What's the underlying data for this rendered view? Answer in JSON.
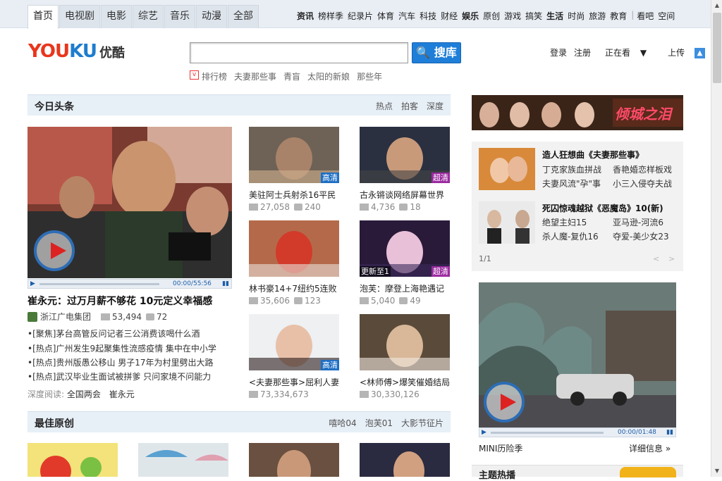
{
  "nav": {
    "tabs": [
      "首页",
      "电视剧",
      "电影",
      "综艺",
      "音乐",
      "动漫",
      "全部"
    ],
    "channels": [
      {
        "label": "资讯",
        "bold": true
      },
      {
        "label": "榜样季"
      },
      {
        "label": "纪录片"
      },
      {
        "label": "体育"
      },
      {
        "label": "汽车"
      },
      {
        "label": "科技"
      },
      {
        "label": "财经"
      },
      {
        "label": "娱乐",
        "bold": true
      },
      {
        "label": "原创"
      },
      {
        "label": "游戏"
      },
      {
        "label": "搞笑"
      },
      {
        "label": "生活",
        "bold": true
      },
      {
        "label": "时尚"
      },
      {
        "label": "旅游"
      },
      {
        "label": "教育"
      }
    ],
    "extra": [
      "看吧",
      "空间"
    ]
  },
  "logo": {
    "brand_en": "YOUKU",
    "brand_cn": "优酷"
  },
  "search": {
    "value": "",
    "button": "搜库"
  },
  "hot_searches": [
    "排行榜",
    "夫妻那些事",
    "青盲",
    "太阳的新娘",
    "那些年"
  ],
  "user": {
    "login": "登录",
    "register": "注册",
    "watching": "正在看",
    "upload": "上传"
  },
  "today": {
    "title": "今日头条",
    "links": [
      "热点",
      "拍客",
      "深度"
    ],
    "main_video": {
      "time": "00:00/55:56",
      "headline": "崔永元：过万月薪不够花 10元定义幸福感",
      "source": "浙江广电集团",
      "plays": "53,494",
      "comments": "72"
    },
    "news": [
      "•[聚焦]茅台高管反问记者三公消费该喝什么酒",
      "•[热点]广州发生9起聚集性流感疫情 集中在中小学",
      "•[热点]贵州版愚公移山 男子17年为村里劈出大路",
      "•[热点]武汉毕业生面试被拼爹 只问家境不问能力"
    ],
    "deep_label": "深度阅读:",
    "deep_links": [
      "全国两会",
      "崔永元"
    ]
  },
  "videos": [
    {
      "caption": "美驻阿士兵射杀16平民",
      "plays": "27,058",
      "comments": "240",
      "badge": "高清",
      "badge_type": "hd"
    },
    {
      "caption": "古永锵谈网络屏幕世界",
      "plays": "4,736",
      "comments": "18",
      "badge": "超清",
      "badge_type": "chao"
    },
    {
      "caption": "林书豪14+7纽约5连败",
      "plays": "35,606",
      "comments": "123",
      "badge": "",
      "badge_type": ""
    },
    {
      "caption": "泡芙：摩登上海艳遇记",
      "plays": "5,040",
      "comments": "49",
      "badge": "超清",
      "badge_type": "chao",
      "update": "更新至1"
    },
    {
      "caption": "<夫妻那些事>屈利人妻",
      "plays": "73,334,673",
      "comments": "",
      "badge": "高清",
      "badge_type": "hd"
    },
    {
      "caption": "<林师傅>爆笑催婚结局",
      "plays": "30,330,126",
      "comments": "",
      "badge": "",
      "badge_type": ""
    }
  ],
  "original": {
    "title": "最佳原创",
    "links": [
      "嘻哈04",
      "泡芙01",
      "大影节征片"
    ]
  },
  "right": {
    "banner_text": "倾城之泪",
    "items": [
      {
        "title": "造人狂想曲《夫妻那些事》",
        "links": [
          "丁克家族血拼战",
          "香艳婚恋样板戏",
          "夫妻风流\"孕\"事",
          "小三入侵夺夫战"
        ]
      },
      {
        "title": "死囚惊魂越狱《恶魔岛》10(新)",
        "links": [
          "绝望主妇15",
          "亚马逊-河流6",
          "杀人魔-复仇16",
          "夺爱-美少女23"
        ]
      }
    ],
    "pager": "1/1",
    "video_time": "00:00/01:48",
    "video_caption": "MINI历险季",
    "detail": "详细信息",
    "topic": "主题热播"
  }
}
